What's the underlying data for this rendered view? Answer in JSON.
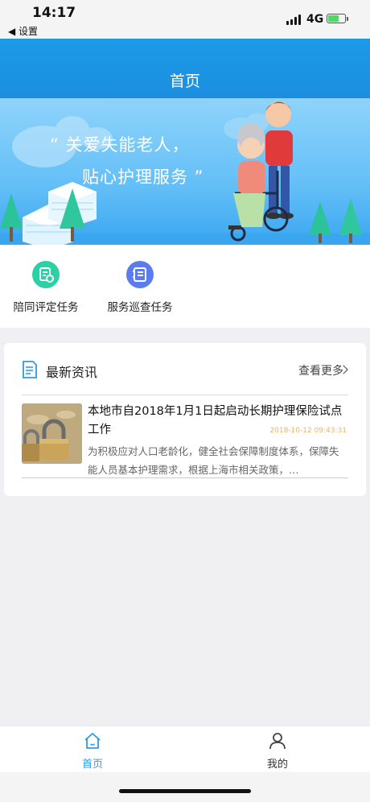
{
  "status_bar": {
    "time": "14:17",
    "back_label": "◀ 设置",
    "network": "4G"
  },
  "nav": {
    "title": "首页"
  },
  "banner": {
    "line1": "“ 关爱失能老人，",
    "line2": "贴心护理服务 ”"
  },
  "quick_entries": [
    {
      "label": "陪同评定任务",
      "icon": "assessment-doc-icon",
      "color": "#2bd0a4"
    },
    {
      "label": "服务巡查任务",
      "icon": "inspection-list-icon",
      "color": "#5b7cf0"
    }
  ],
  "news": {
    "title": "最新资讯",
    "more_label": "查看更多",
    "items": [
      {
        "title": "本地市自2018年1月1日起启动长期护理保险试点工作",
        "date": "2018-10-12 09:43:31",
        "summary": "为积极应对人口老龄化，健全社会保障制度体系，保障失能人员基本护理需求，根据上海市相关政策，…"
      }
    ]
  },
  "tabs": [
    {
      "label": "首页",
      "icon": "home-icon",
      "active": true,
      "color": "#2e9be6"
    },
    {
      "label": "我的",
      "icon": "user-icon",
      "active": false,
      "color": "#333333"
    }
  ]
}
